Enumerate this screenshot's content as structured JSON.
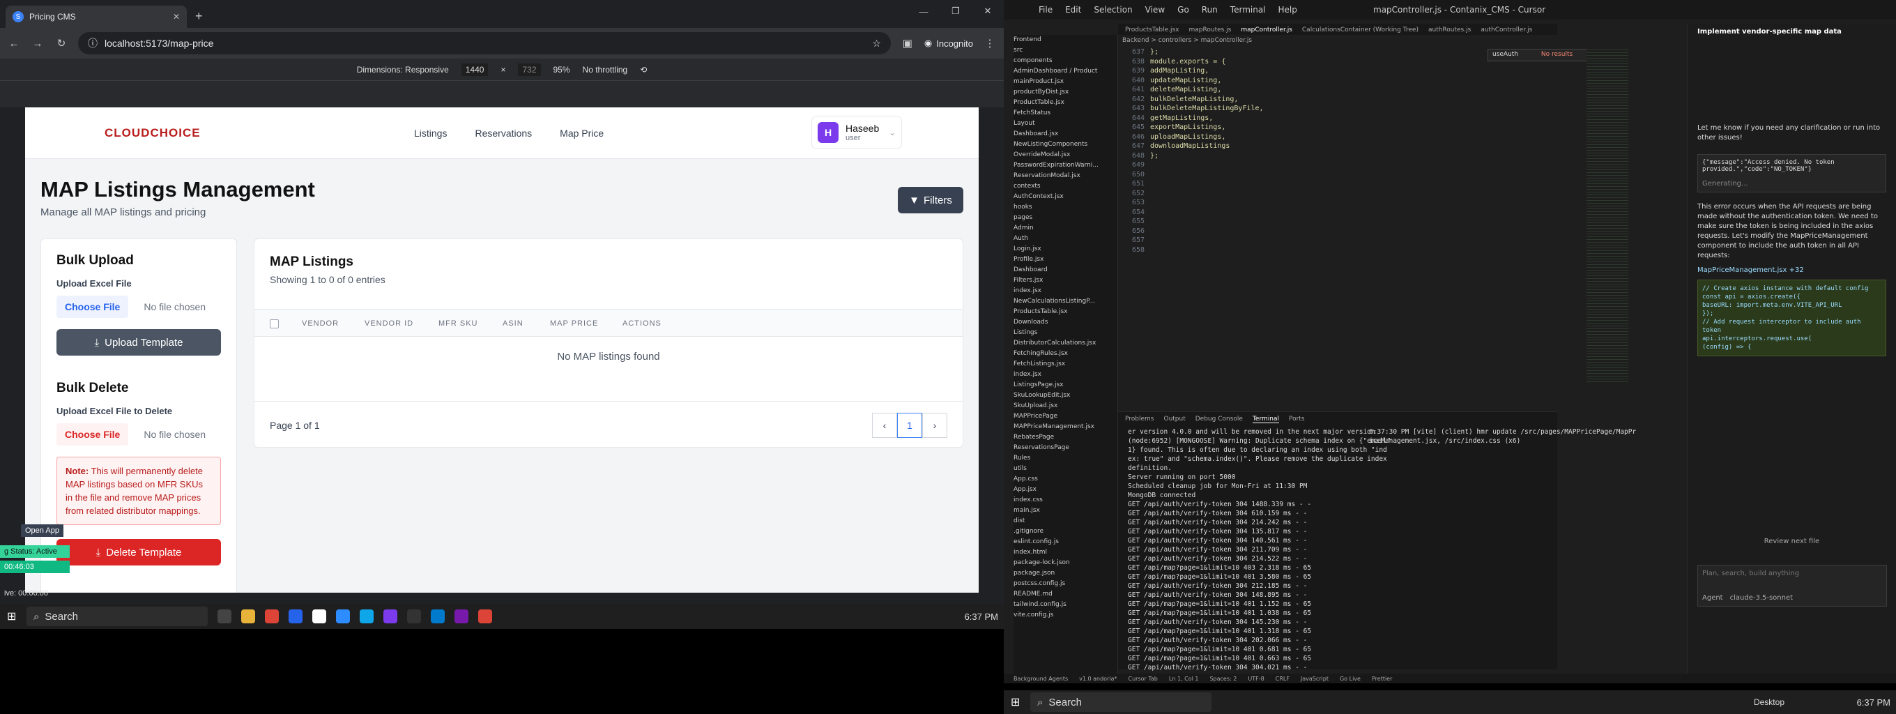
{
  "browser": {
    "tab_title": "Pricing CMS",
    "url": "localhost:5173/map-price",
    "incognito_label": "Incognito",
    "devtools": {
      "dimensions": "Dimensions: Responsive",
      "width": "1440",
      "height": "732",
      "zoom": "95%",
      "throttling": "No throttling"
    }
  },
  "app": {
    "logo": "CLOUDCHOICE",
    "nav": [
      "Listings",
      "Reservations",
      "Map Price"
    ],
    "user": {
      "initial": "H",
      "name": "Haseeb",
      "role": "user"
    },
    "page_title": "MAP Listings Management",
    "page_subtitle": "Manage all MAP listings and pricing",
    "filters_button": "Filters",
    "bulk_upload": {
      "title": "Bulk Upload",
      "label": "Upload Excel File",
      "choose": "Choose File",
      "nofile": "No file chosen",
      "button": "Upload Template"
    },
    "bulk_delete": {
      "title": "Bulk Delete",
      "label": "Upload Excel File to Delete",
      "choose": "Choose File",
      "nofile": "No file chosen",
      "note_prefix": "Note:",
      "note": "This will permanently delete MAP listings based on MFR SKUs in the file and remove MAP prices from related distributor mappings.",
      "button": "Delete Template"
    },
    "listings": {
      "title": "MAP Listings",
      "showing": "Showing 1 to 0 of 0 entries",
      "columns": [
        "VENDOR",
        "VENDOR ID",
        "MFR SKU",
        "ASIN",
        "MAP PRICE",
        "ACTIONS"
      ],
      "empty": "No MAP listings found",
      "page_info": "Page 1 of 1",
      "current_page": "1"
    }
  },
  "overlay": {
    "open_app": "Open App",
    "status": "g Status: Active",
    "timer": "00:46:03",
    "live": "ive: 00:00:00"
  },
  "taskbar": {
    "search": "Search",
    "clock_left": "6:37 PM",
    "clock_right": "6:37 PM",
    "desktop": "Desktop"
  },
  "ide": {
    "title": "mapController.js - Contanix_CMS - Cursor",
    "menu": [
      "File",
      "Edit",
      "Selection",
      "View",
      "Go",
      "Run",
      "Terminal",
      "Help"
    ],
    "tabs": [
      "ProductsTable.jsx",
      "mapRoutes.js",
      "mapController.js",
      "CalculationsContainer (Working Tree)",
      "authRoutes.js",
      "authController.js"
    ],
    "breadcrumb": "Backend > controllers > mapController.js",
    "find": "useAuth",
    "find_result": "No results",
    "line_numbers": [
      "637",
      "638",
      "639",
      "640",
      "641",
      "642",
      "643",
      "644",
      "645",
      "646",
      "647",
      "648",
      "649",
      "650",
      "651",
      "652",
      "653",
      "654",
      "655",
      "656",
      "657",
      "658"
    ],
    "code": [
      "};",
      "",
      "module.exports = {",
      "  addMapListing,",
      "  updateMapListing,",
      "  deleteMapListing,",
      "  bulkDeleteMapListing,",
      "  bulkDeleteMapListingByFile,",
      "  getMapListings,",
      "  exportMapListings,",
      "  uploadMapListings,",
      "  downloadMapListings",
      "};"
    ],
    "explorer": [
      "Frontend",
      "src",
      "components",
      "AdminDashboard / Product",
      "mainProduct.jsx",
      "productByDist.jsx",
      "ProductTable.jsx",
      "FetchStatus",
      "Layout",
      "Dashboard.jsx",
      "NewListingComponents",
      "OverrideModal.jsx",
      "PasswordExpirationWarni...",
      "ReservationModal.jsx",
      "contexts",
      "AuthContext.jsx",
      "hooks",
      "pages",
      "Admin",
      "Auth",
      "Login.jsx",
      "Profile.jsx",
      "Dashboard",
      "Filters.jsx",
      "index.jsx",
      "NewCalculationsListingP...",
      "ProductsTable.jsx",
      "Downloads",
      "Listings",
      "DistributorCalculations.jsx",
      "FetchingRules.jsx",
      "FetchListings.jsx",
      "index.jsx",
      "ListingsPage.jsx",
      "SkuLookupEdit.jsx",
      "SkuUpload.jsx",
      "MAPPricePage",
      "MAPPriceManagement.jsx",
      "RebatesPage",
      "ReservationsPage",
      "Rules",
      "utils",
      "App.css",
      "App.jsx",
      "index.css",
      "main.jsx",
      "dist",
      ".gitignore",
      "eslint.config.js",
      "index.html",
      "package-lock.json",
      "package.json",
      "postcss.config.js",
      "README.md",
      "tailwind.config.js",
      "vite.config.js"
    ],
    "terminal_tabs": [
      "Problems",
      "Output",
      "Debug Console",
      "Terminal",
      "Ports"
    ],
    "terminal_left": [
      "er version 4.0.0 and will be removed in the next major version",
      "(node:6952) [MONGOOSE] Warning: Duplicate schema index on {\"email\"",
      "1} found. This is often due to declaring an index using both \"ind",
      "ex: true\" and \"schema.index()\". Please remove the duplicate index",
      "definition.",
      "Server running on port 5000",
      "Scheduled cleanup job for Mon-Fri at 11:30 PM",
      "MongoDB connected",
      "GET /api/auth/verify-token 304 1488.339 ms - -",
      "GET /api/auth/verify-token 304 610.159 ms - -",
      "GET /api/auth/verify-token 304 214.242 ms - -",
      "GET /api/auth/verify-token 304 135.817 ms - -",
      "GET /api/auth/verify-token 304 140.561 ms - -",
      "GET /api/auth/verify-token 304 211.709 ms - -",
      "GET /api/auth/verify-token 304 214.522 ms - -",
      "GET /api/map?page=1&limit=10 403 2.318 ms - 65",
      "GET /api/map?page=1&limit=10 401 3.580 ms - 65",
      "GET /api/auth/verify-token 304 212.185 ms - -",
      "GET /api/auth/verify-token 304 148.895 ms - -",
      "GET /api/map?page=1&limit=10 401 1.152 ms - 65",
      "GET /api/map?page=1&limit=10 401 1.038 ms - 65",
      "GET /api/auth/verify-token 304 145.230 ms - -",
      "GET /api/map?page=1&limit=10 401 1.318 ms - 65",
      "GET /api/auth/verify-token 304 202.066 ms - -",
      "GET /api/map?page=1&limit=10 401 0.681 ms - 65",
      "GET /api/map?page=1&limit=10 401 0.663 ms - 65",
      "GET /api/auth/verify-token 304 304.021 ms - -"
    ],
    "terminal_right": [
      "6:37:30 PM [vite] (client) hmr update /src/pages/MAPPricePage/MapPr",
      "iceManagement.jsx, /src/index.css (x6)"
    ],
    "chat": {
      "header": "Implement vendor-specific map data",
      "msg1": "Let me know if you need any clarification or run into other issues!",
      "error": "{\"message\":\"Access denied. No token provided.\",\"code\":\"NO_TOKEN\"}",
      "generating": "Generating...",
      "msg2": "This error occurs when the API requests are being made without the authentication token. We need to make sure the token is being included in the axios requests. Let's modify the MapPriceManagement component to include the auth token in all API requests:",
      "file": "MapPriceManagement.jsx +32",
      "code": [
        "// Create axios instance with default config",
        "const api = axios.create({",
        "  baseURL: import.meta.env.VITE_API_URL",
        "});",
        "",
        "// Add request interceptor to include auth token",
        "api.interceptors.request.use(",
        "  (config) => {"
      ],
      "review": "Review next file",
      "input": "Plan, search, build anything",
      "agent": "Agent",
      "model": "claude-3.5-sonnet"
    },
    "status": [
      "Background Agents",
      "v1.0 andoria*",
      "Cursor Tab",
      "Ln 1, Col 1",
      "Spaces: 2",
      "UTF-8",
      "CRLF",
      "JavaScript",
      "Go Live",
      "Prettier"
    ]
  }
}
